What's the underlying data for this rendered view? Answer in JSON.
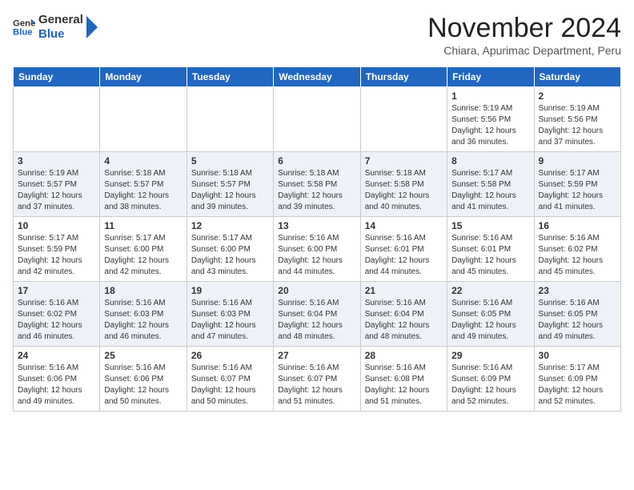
{
  "header": {
    "logo_general": "General",
    "logo_blue": "Blue",
    "month_title": "November 2024",
    "location": "Chiara, Apurimac Department, Peru"
  },
  "days_of_week": [
    "Sunday",
    "Monday",
    "Tuesday",
    "Wednesday",
    "Thursday",
    "Friday",
    "Saturday"
  ],
  "weeks": [
    [
      {
        "day": "",
        "info": ""
      },
      {
        "day": "",
        "info": ""
      },
      {
        "day": "",
        "info": ""
      },
      {
        "day": "",
        "info": ""
      },
      {
        "day": "",
        "info": ""
      },
      {
        "day": "1",
        "info": "Sunrise: 5:19 AM\nSunset: 5:56 PM\nDaylight: 12 hours\nand 36 minutes."
      },
      {
        "day": "2",
        "info": "Sunrise: 5:19 AM\nSunset: 5:56 PM\nDaylight: 12 hours\nand 37 minutes."
      }
    ],
    [
      {
        "day": "3",
        "info": "Sunrise: 5:19 AM\nSunset: 5:57 PM\nDaylight: 12 hours\nand 37 minutes."
      },
      {
        "day": "4",
        "info": "Sunrise: 5:18 AM\nSunset: 5:57 PM\nDaylight: 12 hours\nand 38 minutes."
      },
      {
        "day": "5",
        "info": "Sunrise: 5:18 AM\nSunset: 5:57 PM\nDaylight: 12 hours\nand 39 minutes."
      },
      {
        "day": "6",
        "info": "Sunrise: 5:18 AM\nSunset: 5:58 PM\nDaylight: 12 hours\nand 39 minutes."
      },
      {
        "day": "7",
        "info": "Sunrise: 5:18 AM\nSunset: 5:58 PM\nDaylight: 12 hours\nand 40 minutes."
      },
      {
        "day": "8",
        "info": "Sunrise: 5:17 AM\nSunset: 5:58 PM\nDaylight: 12 hours\nand 41 minutes."
      },
      {
        "day": "9",
        "info": "Sunrise: 5:17 AM\nSunset: 5:59 PM\nDaylight: 12 hours\nand 41 minutes."
      }
    ],
    [
      {
        "day": "10",
        "info": "Sunrise: 5:17 AM\nSunset: 5:59 PM\nDaylight: 12 hours\nand 42 minutes."
      },
      {
        "day": "11",
        "info": "Sunrise: 5:17 AM\nSunset: 6:00 PM\nDaylight: 12 hours\nand 42 minutes."
      },
      {
        "day": "12",
        "info": "Sunrise: 5:17 AM\nSunset: 6:00 PM\nDaylight: 12 hours\nand 43 minutes."
      },
      {
        "day": "13",
        "info": "Sunrise: 5:16 AM\nSunset: 6:00 PM\nDaylight: 12 hours\nand 44 minutes."
      },
      {
        "day": "14",
        "info": "Sunrise: 5:16 AM\nSunset: 6:01 PM\nDaylight: 12 hours\nand 44 minutes."
      },
      {
        "day": "15",
        "info": "Sunrise: 5:16 AM\nSunset: 6:01 PM\nDaylight: 12 hours\nand 45 minutes."
      },
      {
        "day": "16",
        "info": "Sunrise: 5:16 AM\nSunset: 6:02 PM\nDaylight: 12 hours\nand 45 minutes."
      }
    ],
    [
      {
        "day": "17",
        "info": "Sunrise: 5:16 AM\nSunset: 6:02 PM\nDaylight: 12 hours\nand 46 minutes."
      },
      {
        "day": "18",
        "info": "Sunrise: 5:16 AM\nSunset: 6:03 PM\nDaylight: 12 hours\nand 46 minutes."
      },
      {
        "day": "19",
        "info": "Sunrise: 5:16 AM\nSunset: 6:03 PM\nDaylight: 12 hours\nand 47 minutes."
      },
      {
        "day": "20",
        "info": "Sunrise: 5:16 AM\nSunset: 6:04 PM\nDaylight: 12 hours\nand 48 minutes."
      },
      {
        "day": "21",
        "info": "Sunrise: 5:16 AM\nSunset: 6:04 PM\nDaylight: 12 hours\nand 48 minutes."
      },
      {
        "day": "22",
        "info": "Sunrise: 5:16 AM\nSunset: 6:05 PM\nDaylight: 12 hours\nand 49 minutes."
      },
      {
        "day": "23",
        "info": "Sunrise: 5:16 AM\nSunset: 6:05 PM\nDaylight: 12 hours\nand 49 minutes."
      }
    ],
    [
      {
        "day": "24",
        "info": "Sunrise: 5:16 AM\nSunset: 6:06 PM\nDaylight: 12 hours\nand 49 minutes."
      },
      {
        "day": "25",
        "info": "Sunrise: 5:16 AM\nSunset: 6:06 PM\nDaylight: 12 hours\nand 50 minutes."
      },
      {
        "day": "26",
        "info": "Sunrise: 5:16 AM\nSunset: 6:07 PM\nDaylight: 12 hours\nand 50 minutes."
      },
      {
        "day": "27",
        "info": "Sunrise: 5:16 AM\nSunset: 6:07 PM\nDaylight: 12 hours\nand 51 minutes."
      },
      {
        "day": "28",
        "info": "Sunrise: 5:16 AM\nSunset: 6:08 PM\nDaylight: 12 hours\nand 51 minutes."
      },
      {
        "day": "29",
        "info": "Sunrise: 5:16 AM\nSunset: 6:09 PM\nDaylight: 12 hours\nand 52 minutes."
      },
      {
        "day": "30",
        "info": "Sunrise: 5:17 AM\nSunset: 6:09 PM\nDaylight: 12 hours\nand 52 minutes."
      }
    ]
  ]
}
